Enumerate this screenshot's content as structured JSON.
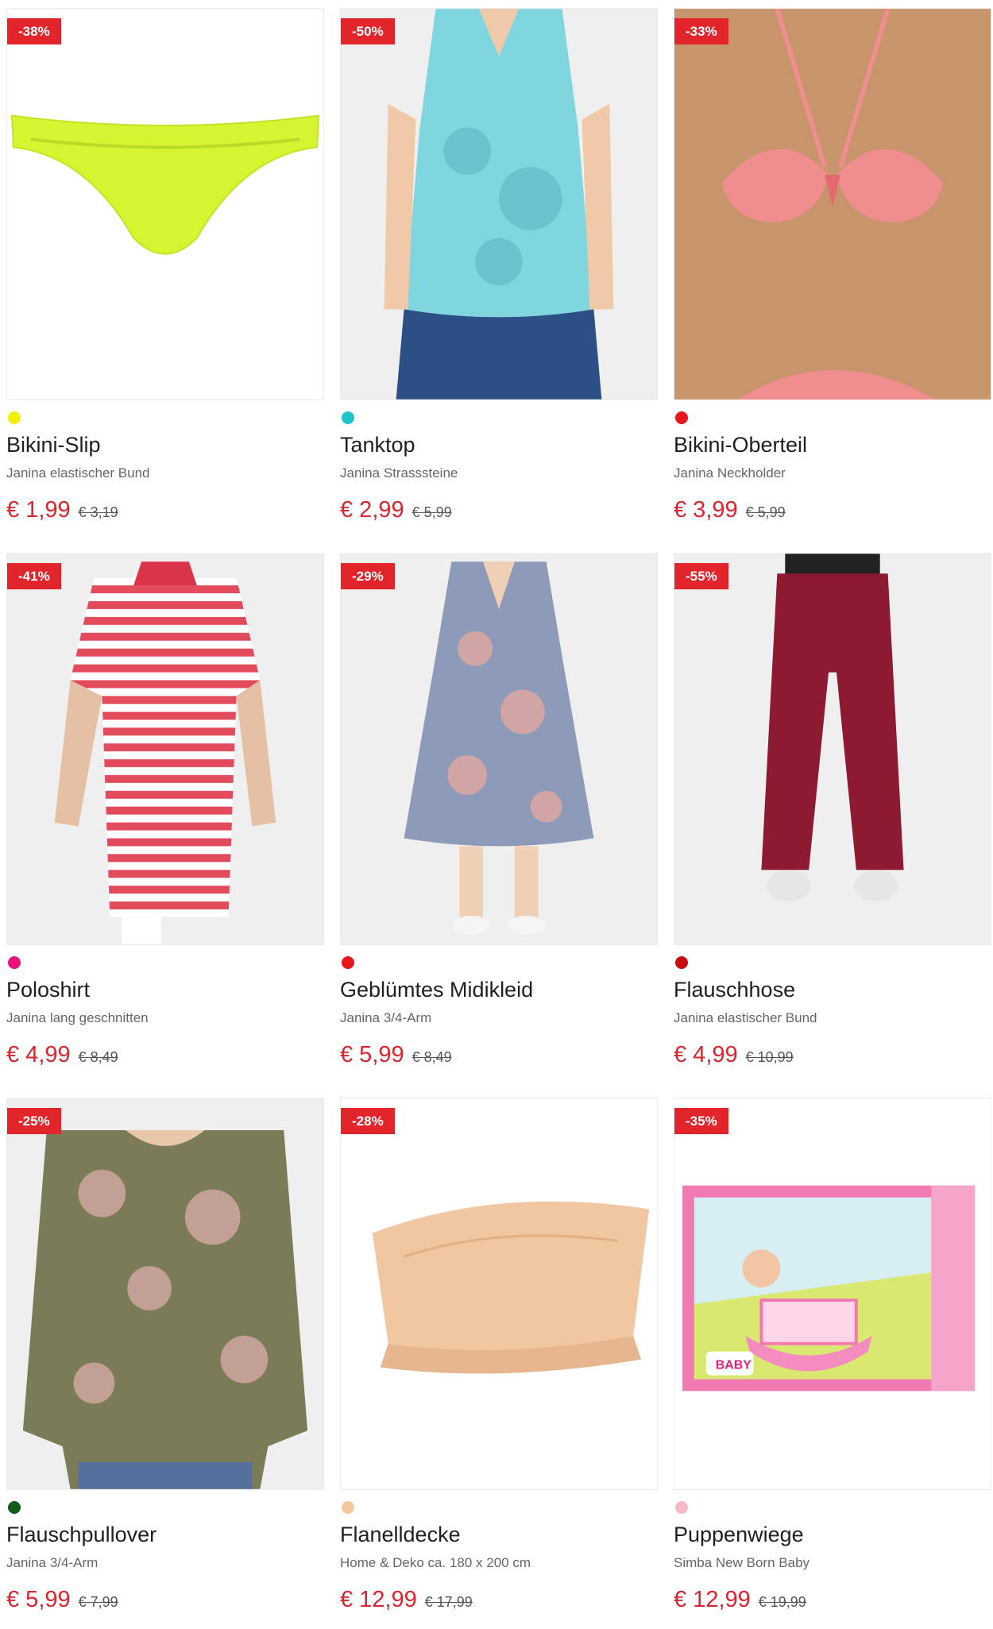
{
  "products": [
    {
      "badge": "-38%",
      "title": "Bikini-Slip",
      "subtitle": "Janina elastischer Bund",
      "price": "€ 1,99",
      "old_price": "€ 3,19",
      "dot_color": "#f2f000",
      "image": "bikini-slip-image"
    },
    {
      "badge": "-50%",
      "title": "Tanktop",
      "subtitle": "Janina Strasssteine",
      "price": "€ 2,99",
      "old_price": "€ 5,99",
      "dot_color": "#1ec3cc",
      "image": "tanktop-image"
    },
    {
      "badge": "-33%",
      "title": "Bikini-Oberteil",
      "subtitle": "Janina Neckholder",
      "price": "€ 3,99",
      "old_price": "€ 5,99",
      "dot_color": "#e8171b",
      "image": "bikini-top-image"
    },
    {
      "badge": "-41%",
      "title": "Poloshirt",
      "subtitle": "Janina lang geschnitten",
      "price": "€ 4,99",
      "old_price": "€ 8,49",
      "dot_color": "#e6147a",
      "image": "poloshirt-image"
    },
    {
      "badge": "-29%",
      "title": "Geblümtes Midikleid",
      "subtitle": "Janina 3/4-Arm",
      "price": "€ 5,99",
      "old_price": "€ 8,49",
      "dot_color": "#e8171b",
      "image": "midikleid-image"
    },
    {
      "badge": "-55%",
      "title": "Flauschhose",
      "subtitle": "Janina elastischer Bund",
      "price": "€ 4,99",
      "old_price": "€ 10,99",
      "dot_color": "#c40d12",
      "image": "flauschhose-image"
    },
    {
      "badge": "-25%",
      "title": "Flauschpullover",
      "subtitle": "Janina 3/4-Arm",
      "price": "€ 5,99",
      "old_price": "€ 7,99",
      "dot_color": "#0e5c18",
      "image": "flauschpullover-image"
    },
    {
      "badge": "-28%",
      "title": "Flanelldecke",
      "subtitle": "Home & Deko ca. 180 x 200 cm",
      "price": "€ 12,99",
      "old_price": "€ 17,99",
      "dot_color": "#f2c99b",
      "image": "flanelldecke-image"
    },
    {
      "badge": "-35%",
      "title": "Puppenwiege",
      "subtitle": "Simba New Born Baby",
      "price": "€ 12,99",
      "old_price": "€ 19,99",
      "dot_color": "#f6b8c6",
      "image": "puppenwiege-image"
    }
  ],
  "box_logo_text": "BABY"
}
